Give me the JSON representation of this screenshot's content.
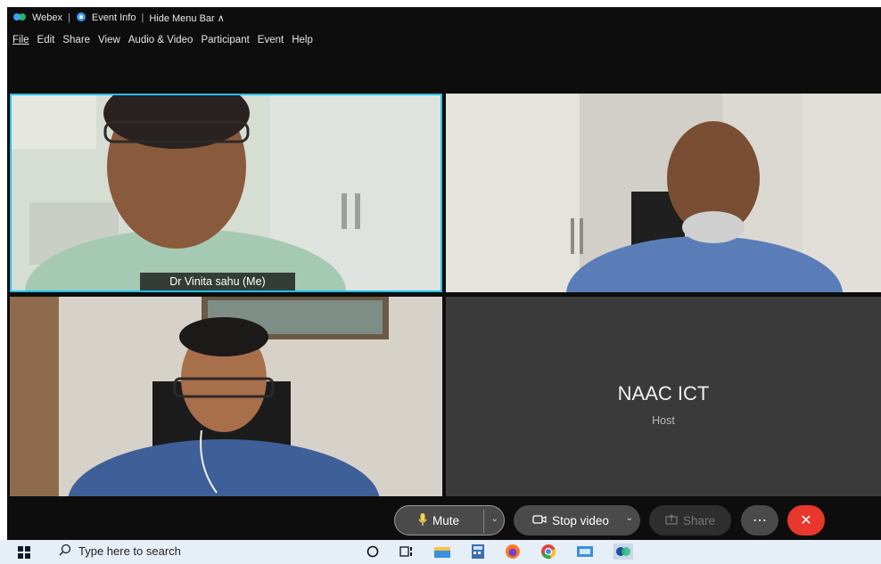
{
  "titlebar": {
    "app_name": "Webex",
    "event_info": "Event Info",
    "hide_menu": "Hide Menu Bar ∧"
  },
  "menu": {
    "items": [
      "File",
      "Edit",
      "Share",
      "View",
      "Audio & Video",
      "Participant",
      "Event",
      "Help"
    ]
  },
  "tiles": {
    "self": {
      "label": "Dr Vinita sahu  (Me)"
    },
    "host": {
      "name": "NAAC ICT",
      "role": "Host"
    }
  },
  "controls": {
    "mute_label": "Mute",
    "stop_video_label": "Stop video",
    "share_label": "Share",
    "more_label": "⋯",
    "leave_label": "✕"
  },
  "taskbar": {
    "search_placeholder": "Type here to search"
  },
  "colors": {
    "active_border": "#25c0e8",
    "leave_red": "#e8372c"
  }
}
